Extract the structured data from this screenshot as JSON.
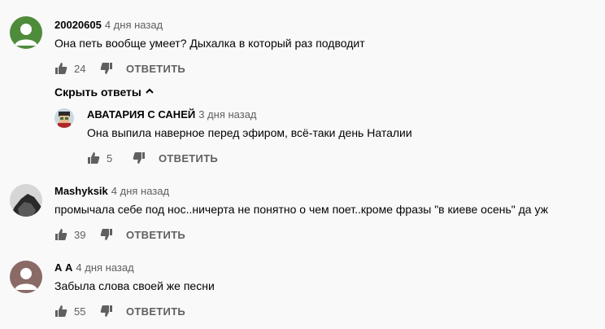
{
  "labels": {
    "reply": "ОТВЕТИТЬ",
    "hide_replies": "Скрыть ответы"
  },
  "comments": [
    {
      "author": "20020605",
      "time": "4 дня назад",
      "text": "Она петь вообще умеет? Дыхалка в который раз подводит",
      "likes": "24",
      "avatar_color": "#4e8b3a"
    },
    {
      "author": "АВАТАРИЯ С САНЕЙ",
      "time": "3 дня назад",
      "text": "Она выпила наверное перед эфиром, всё-таки день Наталии",
      "likes": "5"
    },
    {
      "author": "Mashyksik",
      "time": "4 дня назад",
      "text": "промычала себе под нос..ничерта не понятно о чем поет..кроме фразы \"в киеве осень\" да уж",
      "likes": "39"
    },
    {
      "author": "А А",
      "time": "4 дня назад",
      "text": "Забыла слова своей же песни",
      "likes": "55",
      "avatar_color": "#8a6a66"
    }
  ],
  "icons": {
    "like": "thumbs-up-icon",
    "dislike": "thumbs-down-icon",
    "chevron": "chevron-up-icon"
  }
}
